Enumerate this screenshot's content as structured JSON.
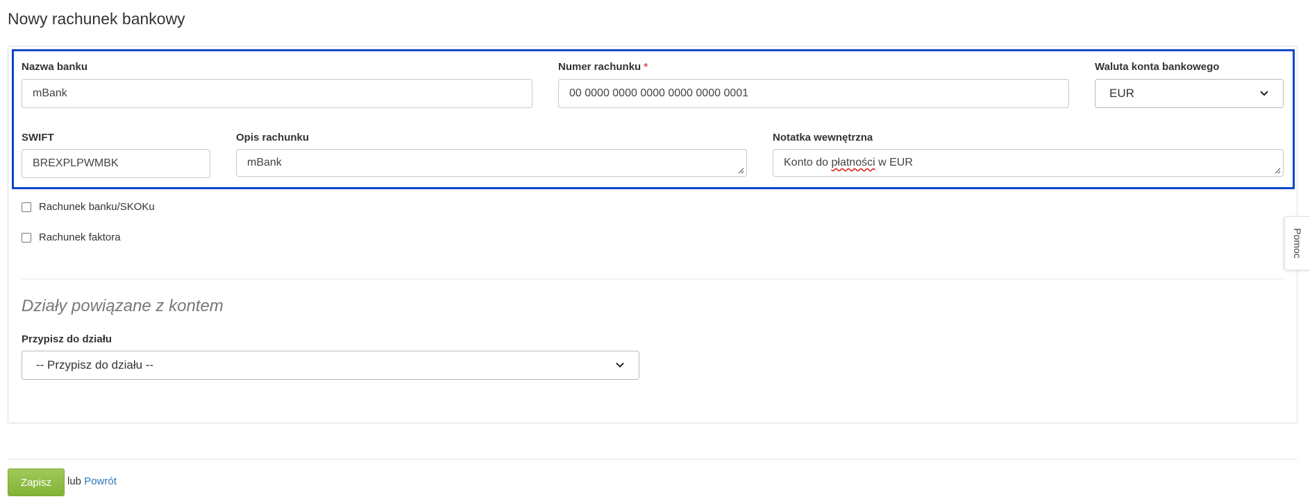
{
  "page_title": "Nowy rachunek bankowy",
  "form": {
    "bank_name": {
      "label": "Nazwa banku",
      "value": "mBank"
    },
    "account_number": {
      "label": "Numer rachunku",
      "required_mark": "*",
      "value": "00 0000 0000 0000 0000 0000 0001"
    },
    "currency": {
      "label": "Waluta konta bankowego",
      "selected": "EUR"
    },
    "swift": {
      "label": "SWIFT",
      "value": "BREXPLPWMBK"
    },
    "description": {
      "label": "Opis rachunku",
      "value": "mBank"
    },
    "internal_note": {
      "label": "Notatka wewnętrzna",
      "value_before": "Konto do ",
      "value_misspelled": "płatności",
      "value_after": " w EUR"
    }
  },
  "checkboxes": {
    "bank_skok": {
      "label": "Rachunek banku/SKOKu",
      "checked": false
    },
    "factor": {
      "label": "Rachunek faktora",
      "checked": false
    }
  },
  "departments": {
    "heading": "Działy powiązane z kontem",
    "assign_label": "Przypisz do działu",
    "assign_selected": "-- Przypisz do działu --"
  },
  "help_tab": "Pomoc",
  "footer": {
    "save_label": "Zapisz",
    "or_text": "lub",
    "back_label": "Powrót"
  },
  "colors": {
    "highlight": "#0a47c9",
    "save_button": "#8dbb3f",
    "link": "#2e77b8",
    "required": "#d9534f"
  },
  "icons": [
    "chevron-down-icon",
    "resize-grip-icon"
  ]
}
